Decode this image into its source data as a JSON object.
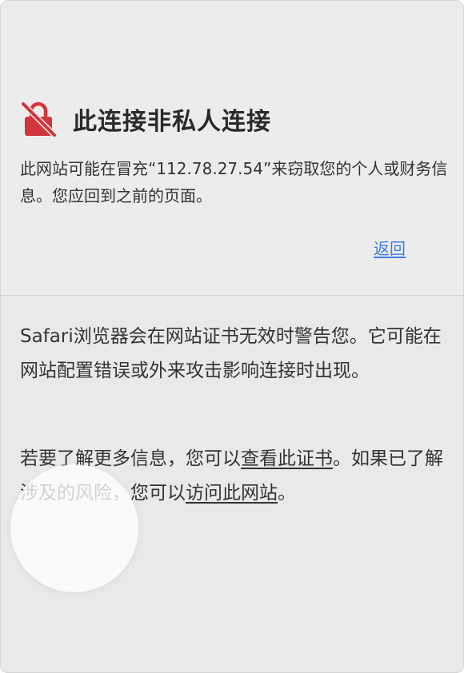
{
  "header": {
    "title": "此连接非私人连接",
    "lock_icon": "lock-slash-icon",
    "lock_color": "#d1353d"
  },
  "warning": {
    "text": "此网站可能在冒充“112.78.27.54”来窃取您的个人或财务信息。您应回到之前的页面。",
    "back_label": "返回",
    "link_color": "#3d7de0"
  },
  "info": {
    "para1": "Safari浏览器会在网站证书无效时警告您。它可能在网站配置错误或外来攻击影响连接时出现。",
    "para2_prefix": "若要了解更多信息，您可以",
    "view_certificate_label": "查看此证书",
    "para2_middle": "。如果已了解涉及的风险，您可以",
    "visit_site_label": "访问此网站",
    "para2_suffix": "。"
  }
}
